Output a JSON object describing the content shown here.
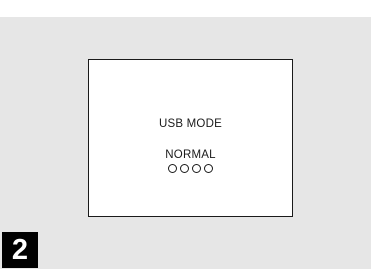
{
  "screen": {
    "title": "USB MODE",
    "status": "NORMAL",
    "indicator_count": 4
  },
  "step": {
    "number": "2"
  }
}
